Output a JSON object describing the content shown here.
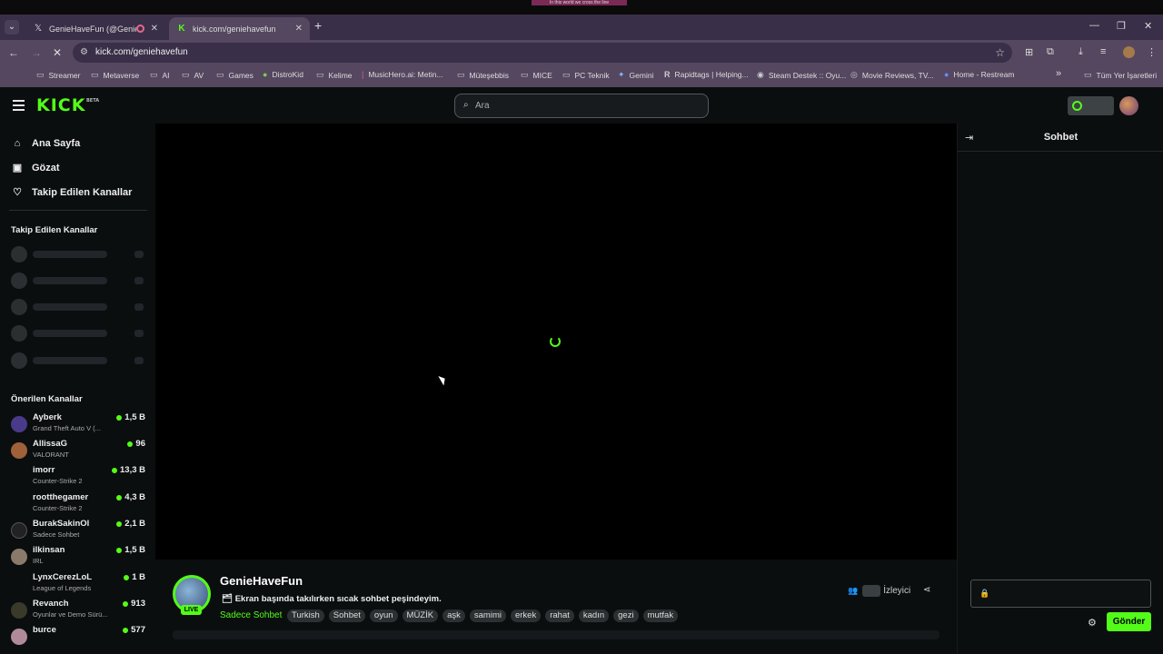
{
  "top_strip": {
    "text": "In this world we cross the line"
  },
  "tabs": [
    {
      "title": "GenieHaveFun (@GenieHaveFun)",
      "favicon": "x-icon",
      "active": false
    },
    {
      "title": "kick.com/geniehavefun",
      "favicon": "kick-icon",
      "active": true
    }
  ],
  "address": {
    "url": "kick.com/geniehavefun"
  },
  "bookmarks": [
    {
      "label": "Streamer",
      "icon": "folder-icon"
    },
    {
      "label": "Metaverse",
      "icon": "folder-icon"
    },
    {
      "label": "AI",
      "icon": "folder-icon"
    },
    {
      "label": "AV",
      "icon": "folder-icon"
    },
    {
      "label": "Games",
      "icon": "folder-icon"
    },
    {
      "label": "DistroKid",
      "icon": "distrokid-icon"
    },
    {
      "label": "Kelime",
      "icon": "folder-icon"
    },
    {
      "label": "MusicHero.ai: Metin...",
      "icon": "musichero-icon"
    },
    {
      "label": "Müteşebbis",
      "icon": "folder-icon"
    },
    {
      "label": "MICE",
      "icon": "folder-icon"
    },
    {
      "label": "PC Teknik",
      "icon": "folder-icon"
    },
    {
      "label": "Gemini",
      "icon": "gemini-icon"
    },
    {
      "label": "Rapidtags | Helping...",
      "icon": "rapidtags-icon"
    },
    {
      "label": "Steam Destek :: Oyu...",
      "icon": "steam-icon"
    },
    {
      "label": "Movie Reviews, TV...",
      "icon": "rottentomatoes-icon"
    },
    {
      "label": "Home - Restream",
      "icon": "restream-icon"
    }
  ],
  "bookmarks_more": "»",
  "bookmarks_all": "Tüm Yer İşaretleri",
  "kick": {
    "logo": "KICK",
    "logo_badge": "BETA",
    "search_placeholder": "Ara",
    "nav": [
      {
        "label": "Ana Sayfa",
        "icon": "home-icon"
      },
      {
        "label": "Gözat",
        "icon": "browse-icon"
      },
      {
        "label": "Takip Edilen Kanallar",
        "icon": "heart-icon"
      }
    ],
    "followed_heading": "Takip Edilen Kanallar",
    "recommended_heading": "Önerilen Kanallar",
    "recommended": [
      {
        "name": "Ayberk",
        "category": "Grand Theft Auto V (...",
        "viewers": "1,5 B",
        "color": "#4a3a8a"
      },
      {
        "name": "AllissaG",
        "category": "VALORANT",
        "viewers": "96",
        "color": "#a0603a"
      },
      {
        "name": "imorr",
        "category": "Counter-Strike 2",
        "viewers": "13,3 B",
        "color": ""
      },
      {
        "name": "rootthegamer",
        "category": "Counter-Strike 2",
        "viewers": "4,3 B",
        "color": ""
      },
      {
        "name": "BurakSakinOl",
        "category": "Sadece Sohbet",
        "viewers": "2,1 B",
        "color": "#222222"
      },
      {
        "name": "ilkinsan",
        "category": "IRL",
        "viewers": "1,5 B",
        "color": "#8a7a6a"
      },
      {
        "name": "LynxCerezLoL",
        "category": "League of Legends",
        "viewers": "1 B",
        "color": ""
      },
      {
        "name": "Revanch",
        "category": "Oyunlar ve Demo Sürü...",
        "viewers": "913",
        "color": "#3a3a2a"
      },
      {
        "name": "burce",
        "category": "",
        "viewers": "577",
        "color": "#b08a9a"
      }
    ],
    "channel": {
      "name": "GenieHaveFun",
      "live": "LIVE",
      "title": "Ekran başında takılırken sıcak sohbet peşindeyim.",
      "category": "Sadece Sohbet",
      "tags": [
        "Turkish",
        "Sohbet",
        "oyun",
        "MÜZİK",
        "aşk",
        "samimi",
        "erkek",
        "rahat",
        "kadın",
        "gezi",
        "mutfak"
      ],
      "viewers_label": "İzleyici"
    },
    "chat": {
      "title": "Sohbet",
      "send": "Gönder"
    }
  }
}
